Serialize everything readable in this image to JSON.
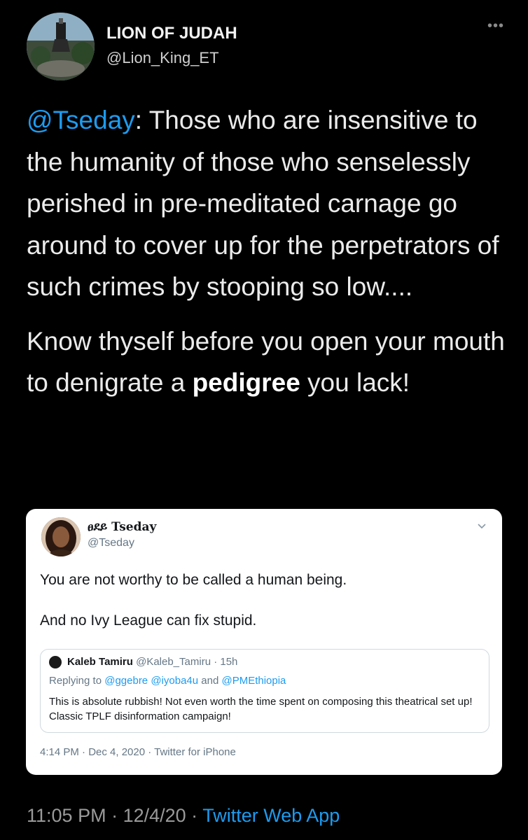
{
  "tweet": {
    "author_name": "LION OF JUDAH",
    "author_handle": "@Lion_King_ET",
    "mention": "@Tseday",
    "paragraph1_rest": ": Those who are insensitive to the humanity of those who senselessly perished in pre-meditated carnage go around to cover up for the perpetrators of such crimes by stooping so low....",
    "paragraph2_start": "Know thyself before you open your mouth to denigrate a ",
    "paragraph2_bold": "pedigree",
    "paragraph2_end": " you lack!",
    "time": "11:05 PM",
    "sep1": " · ",
    "date": "12/4/20",
    "sep2": " · ",
    "source": "Twitter Web App"
  },
  "embedded": {
    "name": "ፀደይ Tseday",
    "handle": "@Tseday",
    "line1": "You are not worthy to be called a human being.",
    "line2": "And no Ivy League can fix stupid.",
    "footer": "4:14 PM · Dec 4, 2020 · Twitter for iPhone",
    "quote": {
      "name": "Kaleb Tamiru",
      "meta": " @Kaleb_Tamiru · 15h",
      "reply_prefix": "Replying to ",
      "reply_mention1": "@ggebre @iyoba4u",
      "reply_and": " and ",
      "reply_mention2": "@PMEthiopia",
      "body": "This is absolute rubbish!  Not even worth the time spent on composing this theatrical set up!  Classic TPLF disinformation campaign!"
    }
  },
  "icons": {
    "more": "more-horizontal-icon",
    "chevron": "chevron-down-icon"
  },
  "colors": {
    "background": "#000000",
    "link": "#1d9bf0",
    "card": "#ffffff"
  }
}
